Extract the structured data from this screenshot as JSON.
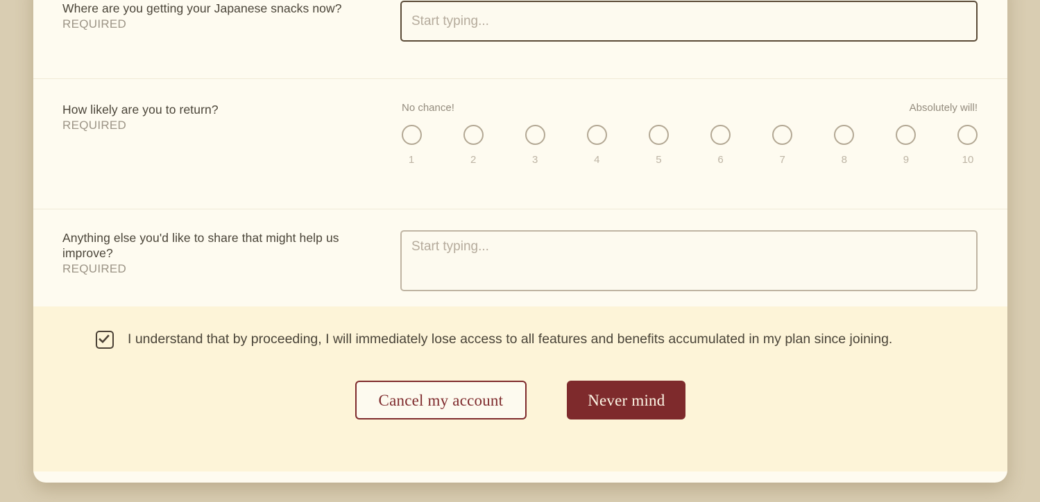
{
  "theme": {
    "page_background": "#d9cdb2",
    "card_background": "#fefbf0",
    "footer_background": "#fdf4d8",
    "accent_maroon": "#7e2a2c",
    "text_primary": "#4a4438",
    "text_muted": "#9c9486",
    "focus_border": "#5a4a36",
    "idle_border": "#bfb4a2"
  },
  "form": {
    "questions": [
      {
        "id": "source",
        "text": "Where are you getting your Japanese snacks now?",
        "required_label": "REQUIRED",
        "input": {
          "type": "text",
          "value": "",
          "placeholder": "Start typing..."
        }
      },
      {
        "id": "likelihood",
        "text": "How likely are you to return?",
        "required_label": "REQUIRED",
        "scale": {
          "low_label": "No chance!",
          "high_label": "Absolutely will!",
          "options": [
            "1",
            "2",
            "3",
            "4",
            "5",
            "6",
            "7",
            "8",
            "9",
            "10"
          ],
          "selected": null
        }
      },
      {
        "id": "improve",
        "text": "Anything else you'd like to share that might help us improve?",
        "required_label": "REQUIRED",
        "input": {
          "type": "textarea",
          "value": "",
          "placeholder": "Start typing..."
        }
      }
    ]
  },
  "footer": {
    "consent": {
      "checked": true,
      "text": "I understand that by proceeding, I will immediately lose access to all features and benefits accumulated in my plan since joining."
    },
    "buttons": {
      "cancel_label": "Cancel my account",
      "dismiss_label": "Never mind"
    }
  }
}
